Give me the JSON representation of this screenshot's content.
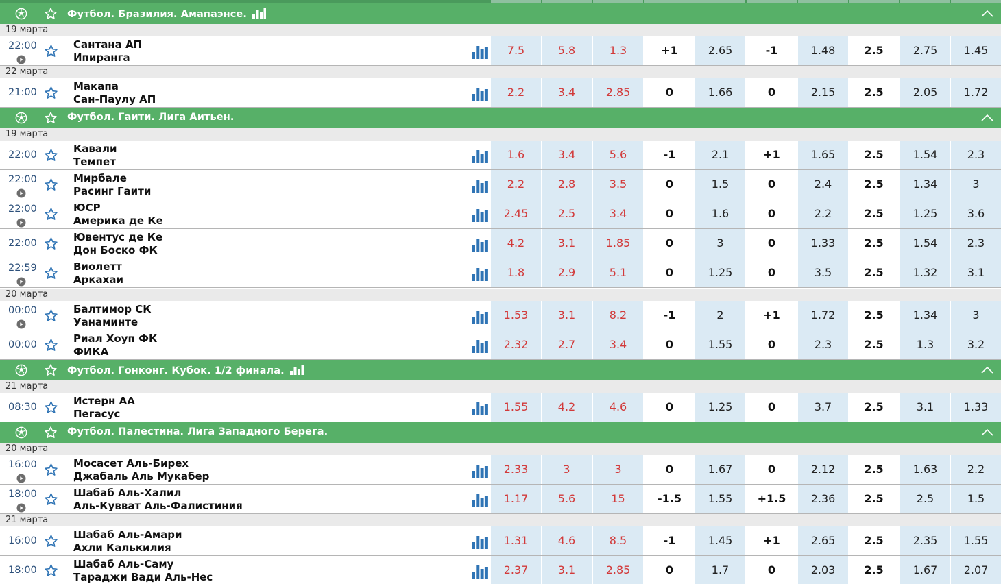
{
  "leagues": [
    {
      "title": "Футбол. Бразилия. Амапаэнсе.",
      "stats": true
    },
    {
      "title": "Футбол. Гаити. Лига Аитьен.",
      "stats": false
    },
    {
      "title": "Футбол. Гонконг. Кубок. 1/2 финала.",
      "stats": true
    },
    {
      "title": "Футбол. Палестина. Лига Западного Берега.",
      "stats": false
    }
  ],
  "dates": [
    "19 марта",
    "22 марта",
    "19 марта",
    "20 марта",
    "21 марта",
    "20 марта",
    "21 марта"
  ],
  "matches": [
    {
      "time": "22:00",
      "live": true,
      "team1": "Сантана АП",
      "team2": "Ипиранга",
      "odds": [
        "7.5",
        "5.8",
        "1.3",
        "+1",
        "2.65",
        "-1",
        "1.48",
        "2.5",
        "2.75",
        "1.45"
      ]
    },
    {
      "time": "21:00",
      "live": false,
      "team1": "Макапа",
      "team2": "Сан-Паулу АП",
      "odds": [
        "2.2",
        "3.4",
        "2.85",
        "0",
        "1.66",
        "0",
        "2.15",
        "2.5",
        "2.05",
        "1.72"
      ]
    },
    {
      "time": "22:00",
      "live": false,
      "team1": "Кавали",
      "team2": "Темпет",
      "odds": [
        "1.6",
        "3.4",
        "5.6",
        "-1",
        "2.1",
        "+1",
        "1.65",
        "2.5",
        "1.54",
        "2.3"
      ]
    },
    {
      "time": "22:00",
      "live": true,
      "team1": "Мирбале",
      "team2": "Расинг Гаити",
      "odds": [
        "2.2",
        "2.8",
        "3.5",
        "0",
        "1.5",
        "0",
        "2.4",
        "2.5",
        "1.34",
        "3"
      ]
    },
    {
      "time": "22:00",
      "live": true,
      "team1": "ЮСР",
      "team2": "Америка де Ке",
      "odds": [
        "2.45",
        "2.5",
        "3.4",
        "0",
        "1.6",
        "0",
        "2.2",
        "2.5",
        "1.25",
        "3.6"
      ]
    },
    {
      "time": "22:00",
      "live": false,
      "team1": "Ювентус де Ке",
      "team2": "Дон Боско ФК",
      "odds": [
        "4.2",
        "3.1",
        "1.85",
        "0",
        "3",
        "0",
        "1.33",
        "2.5",
        "1.54",
        "2.3"
      ]
    },
    {
      "time": "22:59",
      "live": true,
      "team1": "Виолетт",
      "team2": "Аркахаи",
      "odds": [
        "1.8",
        "2.9",
        "5.1",
        "0",
        "1.25",
        "0",
        "3.5",
        "2.5",
        "1.32",
        "3.1"
      ]
    },
    {
      "time": "00:00",
      "live": true,
      "team1": "Балтимор СК",
      "team2": "Уанаминте",
      "odds": [
        "1.53",
        "3.1",
        "8.2",
        "-1",
        "2",
        "+1",
        "1.72",
        "2.5",
        "1.34",
        "3"
      ]
    },
    {
      "time": "00:00",
      "live": false,
      "team1": "Риал Хоуп ФК",
      "team2": "ФИКА",
      "odds": [
        "2.32",
        "2.7",
        "3.4",
        "0",
        "1.55",
        "0",
        "2.3",
        "2.5",
        "1.3",
        "3.2"
      ]
    },
    {
      "time": "08:30",
      "live": false,
      "team1": "Истерн АА",
      "team2": "Пегасус",
      "odds": [
        "1.55",
        "4.2",
        "4.6",
        "0",
        "1.25",
        "0",
        "3.7",
        "2.5",
        "3.1",
        "1.33"
      ]
    },
    {
      "time": "16:00",
      "live": true,
      "team1": "Мосасет Аль-Бирех",
      "team2": "Джабаль Аль Мукабер",
      "odds": [
        "2.33",
        "3",
        "3",
        "0",
        "1.67",
        "0",
        "2.12",
        "2.5",
        "1.63",
        "2.2"
      ]
    },
    {
      "time": "18:00",
      "live": true,
      "team1": "Шабаб Аль-Халил",
      "team2": "Аль-Кувват Аль-Фалистиния",
      "odds": [
        "1.17",
        "5.6",
        "15",
        "-1.5",
        "1.55",
        "+1.5",
        "2.36",
        "2.5",
        "2.5",
        "1.5"
      ]
    },
    {
      "time": "16:00",
      "live": false,
      "team1": "Шабаб Аль-Амари",
      "team2": "Ахли Калькилия",
      "odds": [
        "1.31",
        "4.6",
        "8.5",
        "-1",
        "1.45",
        "+1",
        "2.65",
        "2.5",
        "2.35",
        "1.55"
      ]
    },
    {
      "time": "18:00",
      "live": false,
      "team1": "Шабаб Аль-Саму",
      "team2": "Тараджи Вади Аль-Нес",
      "odds": [
        "2.37",
        "3.1",
        "2.85",
        "0",
        "1.7",
        "0",
        "2.03",
        "2.5",
        "1.67",
        "2.07"
      ]
    }
  ],
  "colors": {
    "header_green": "#57b068",
    "odds_blue": "#dbeaf4",
    "odds_red": "#d23a3a",
    "time_blue": "#2b4f7a",
    "date_gray": "#eaeaea",
    "bar_blue": "#2f74b5"
  }
}
